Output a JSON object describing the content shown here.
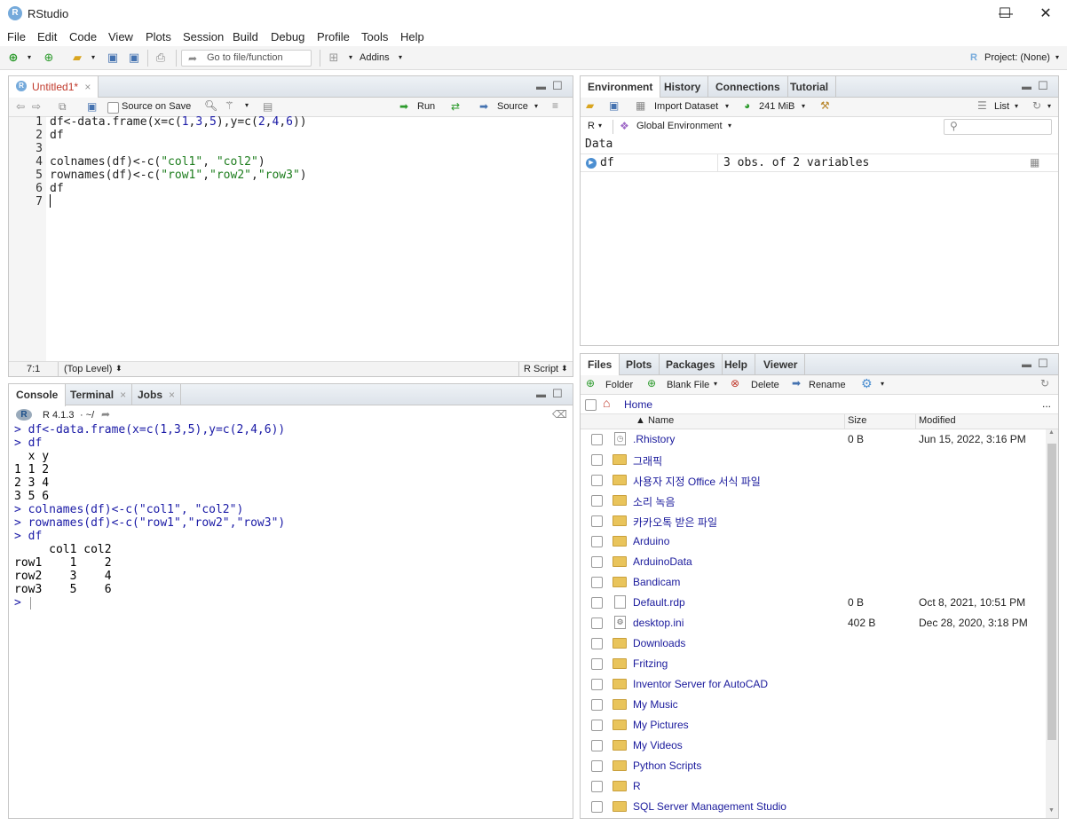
{
  "window": {
    "title": "RStudio",
    "minimize": "—",
    "maximize": "☐",
    "close": "✕"
  },
  "menu": [
    "File",
    "Edit",
    "Code",
    "View",
    "Plots",
    "Session",
    "Build",
    "Debug",
    "Profile",
    "Tools",
    "Help"
  ],
  "toolbar": {
    "goto_placeholder": "Go to file/function",
    "addins": "Addins",
    "project": "Project: (None)"
  },
  "editor": {
    "tab_label": "Untitled1*",
    "source_on_save": "Source on Save",
    "run": "Run",
    "source": "Source",
    "status_pos": "7:1",
    "status_scope": "(Top Level)",
    "status_type": "R Script",
    "lines": [
      {
        "n": "1",
        "segs": [
          {
            "t": "df<-data.frame(x=c(",
            "c": ""
          },
          {
            "t": "1",
            "c": "num"
          },
          {
            "t": ",",
            "c": ""
          },
          {
            "t": "3",
            "c": "num"
          },
          {
            "t": ",",
            "c": ""
          },
          {
            "t": "5",
            "c": "num"
          },
          {
            "t": "),y=c(",
            "c": ""
          },
          {
            "t": "2",
            "c": "num"
          },
          {
            "t": ",",
            "c": ""
          },
          {
            "t": "4",
            "c": "num"
          },
          {
            "t": ",",
            "c": ""
          },
          {
            "t": "6",
            "c": "num"
          },
          {
            "t": "))",
            "c": ""
          }
        ]
      },
      {
        "n": "2",
        "segs": [
          {
            "t": "df",
            "c": ""
          }
        ]
      },
      {
        "n": "3",
        "segs": []
      },
      {
        "n": "4",
        "segs": [
          {
            "t": "colnames(df)<-c(",
            "c": ""
          },
          {
            "t": "\"col1\"",
            "c": "str"
          },
          {
            "t": ", ",
            "c": ""
          },
          {
            "t": "\"col2\"",
            "c": "str"
          },
          {
            "t": ")",
            "c": ""
          }
        ]
      },
      {
        "n": "5",
        "segs": [
          {
            "t": "rownames(df)<-c(",
            "c": ""
          },
          {
            "t": "\"row1\"",
            "c": "str"
          },
          {
            "t": ",",
            "c": ""
          },
          {
            "t": "\"row2\"",
            "c": "str"
          },
          {
            "t": ",",
            "c": ""
          },
          {
            "t": "\"row3\"",
            "c": "str"
          },
          {
            "t": ")",
            "c": ""
          }
        ]
      },
      {
        "n": "6",
        "segs": [
          {
            "t": "df",
            "c": ""
          }
        ]
      },
      {
        "n": "7",
        "segs": []
      }
    ]
  },
  "console": {
    "tabs": [
      "Console",
      "Terminal",
      "Jobs"
    ],
    "r_version": "R 4.1.3",
    "path": "· ~/",
    "lines": [
      {
        "t": "> df<-data.frame(x=c(1,3,5),y=c(2,4,6))",
        "cmd": true
      },
      {
        "t": "> df",
        "cmd": true
      },
      {
        "t": "  x y",
        "cmd": false
      },
      {
        "t": "1 1 2",
        "cmd": false
      },
      {
        "t": "2 3 4",
        "cmd": false
      },
      {
        "t": "3 5 6",
        "cmd": false
      },
      {
        "t": "> colnames(df)<-c(\"col1\", \"col2\")",
        "cmd": true
      },
      {
        "t": "> rownames(df)<-c(\"row1\",\"row2\",\"row3\")",
        "cmd": true
      },
      {
        "t": "> df",
        "cmd": true
      },
      {
        "t": "     col1 col2",
        "cmd": false
      },
      {
        "t": "row1    1    2",
        "cmd": false
      },
      {
        "t": "row2    3    4",
        "cmd": false
      },
      {
        "t": "row3    5    6",
        "cmd": false
      },
      {
        "t": "> ",
        "cmd": true
      }
    ]
  },
  "environment": {
    "tabs": [
      "Environment",
      "History",
      "Connections",
      "Tutorial"
    ],
    "import_dataset": "Import Dataset",
    "memory": "241 MiB",
    "list_mode": "List",
    "language": "R",
    "scope": "Global Environment",
    "section": "Data",
    "items": [
      {
        "name": "df",
        "value": "3 obs. of 2 variables"
      }
    ]
  },
  "files": {
    "tabs": [
      "Files",
      "Plots",
      "Packages",
      "Help",
      "Viewer"
    ],
    "new_folder": "Folder",
    "blank_file": "Blank File",
    "delete": "Delete",
    "rename": "Rename",
    "breadcrumb": "Home",
    "more": "...",
    "col_name": "▲ Name",
    "col_size": "Size",
    "col_modified": "Modified",
    "rows": [
      {
        "name": ".Rhistory",
        "kind": "history",
        "size": "0 B",
        "modified": "Jun 15, 2022, 3:16 PM"
      },
      {
        "name": "그래픽",
        "kind": "folder",
        "size": "",
        "modified": ""
      },
      {
        "name": "사용자 지정 Office 서식 파일",
        "kind": "folder",
        "size": "",
        "modified": ""
      },
      {
        "name": "소리 녹음",
        "kind": "folder",
        "size": "",
        "modified": ""
      },
      {
        "name": "카카오톡 받은 파일",
        "kind": "folder",
        "size": "",
        "modified": ""
      },
      {
        "name": "Arduino",
        "kind": "folder",
        "size": "",
        "modified": ""
      },
      {
        "name": "ArduinoData",
        "kind": "folder",
        "size": "",
        "modified": ""
      },
      {
        "name": "Bandicam",
        "kind": "folder",
        "size": "",
        "modified": ""
      },
      {
        "name": "Default.rdp",
        "kind": "file",
        "size": "0 B",
        "modified": "Oct 8, 2021, 10:51 PM"
      },
      {
        "name": "desktop.ini",
        "kind": "settings",
        "size": "402 B",
        "modified": "Dec 28, 2020, 3:18 PM"
      },
      {
        "name": "Downloads",
        "kind": "folder",
        "size": "",
        "modified": ""
      },
      {
        "name": "Fritzing",
        "kind": "folder",
        "size": "",
        "modified": ""
      },
      {
        "name": "Inventor Server for AutoCAD",
        "kind": "folder",
        "size": "",
        "modified": ""
      },
      {
        "name": "My Music",
        "kind": "folder",
        "size": "",
        "modified": ""
      },
      {
        "name": "My Pictures",
        "kind": "folder",
        "size": "",
        "modified": ""
      },
      {
        "name": "My Videos",
        "kind": "folder",
        "size": "",
        "modified": ""
      },
      {
        "name": "Python Scripts",
        "kind": "folder",
        "size": "",
        "modified": ""
      },
      {
        "name": "R",
        "kind": "folder",
        "size": "",
        "modified": ""
      },
      {
        "name": "SQL Server Management Studio",
        "kind": "folder",
        "size": "",
        "modified": ""
      }
    ]
  }
}
